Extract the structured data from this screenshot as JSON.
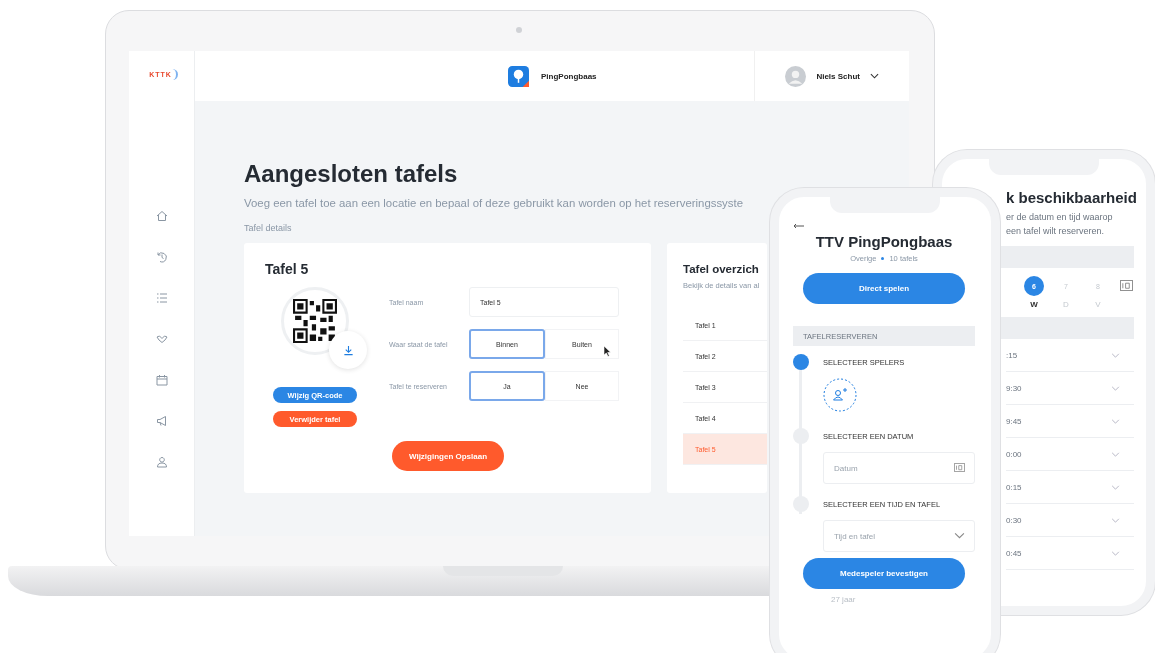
{
  "laptop": {
    "sidebar": {
      "logo": "KTTK",
      "items": [
        {
          "kind": "home"
        },
        {
          "kind": "history"
        },
        {
          "kind": "list"
        },
        {
          "kind": "hands"
        },
        {
          "kind": "calendar"
        },
        {
          "kind": "megaphone"
        },
        {
          "kind": "user"
        }
      ]
    },
    "topbar": {
      "app_name": "PingPongbaas",
      "user_name": "Niels Schut"
    },
    "page": {
      "title": "Aangesloten tafels",
      "subtitle": "Voeg een tafel toe aan een locatie en bepaal of deze gebruikt kan worden op het reserveringssyste",
      "section_label": "Tafel details"
    },
    "detail_card": {
      "title": "Tafel 5",
      "buttons": [
        {
          "label": "Wijzig QR-code",
          "kind": "primary"
        },
        {
          "label": "Verwijder tafel",
          "kind": "danger"
        }
      ],
      "fields": [
        {
          "kind": "text",
          "label": "Tafel naam",
          "value": "Tafel 5"
        },
        {
          "kind": "toggle",
          "label": "Waar staat de tafel",
          "options": [
            {
              "label": "Binnen",
              "selected": true
            },
            {
              "label": "Buiten",
              "selected": false
            }
          ]
        },
        {
          "kind": "toggle",
          "label": "Tafel te reserveren",
          "options": [
            {
              "label": "Ja",
              "selected": true
            },
            {
              "label": "Nee",
              "selected": false
            }
          ]
        }
      ],
      "save_button": "Wijzigingen Opslaan"
    },
    "overview_card": {
      "title": "Tafel overzich",
      "subtitle": "Bekijk de details van al",
      "rows": [
        {
          "label": "Tafel 1",
          "selected": false
        },
        {
          "label": "Tafel 2",
          "selected": false
        },
        {
          "label": "Tafel 3",
          "selected": false
        },
        {
          "label": "Tafel 4",
          "selected": false
        },
        {
          "label": "Tafel 5",
          "selected": true
        }
      ]
    }
  },
  "phone_booking": {
    "title": "TTV PingPongbaas",
    "category": "Overige",
    "table_count": "10 tafels",
    "play_button": "Direct spelen",
    "section_label": "TAFELRESERVEREN",
    "steps": [
      {
        "label": "SELECTEER SPELERS",
        "active": true,
        "kind": "players"
      },
      {
        "label": "SELECTEER EEN DATUM",
        "active": false,
        "kind": "date",
        "placeholder": "Datum"
      },
      {
        "label": "SELECTEER EEN TIJD EN TAFEL",
        "active": false,
        "kind": "select",
        "placeholder": "Tijd en tafel"
      }
    ],
    "confirm_button": "Medespeler bevestigen",
    "player_age": "27 jaar"
  },
  "phone_availability": {
    "title": "k beschikbaarheid",
    "description_lines": [
      "er de datum en tijd waarop",
      "een tafel wilt reserveren."
    ],
    "days": [
      {
        "number": "6",
        "weekday": "W",
        "selected": true
      },
      {
        "number": "7",
        "weekday": "D",
        "selected": false
      },
      {
        "number": "8",
        "weekday": "V",
        "selected": false
      }
    ],
    "times": [
      ":15",
      "9:30",
      "9:45",
      "0:00",
      "0:15",
      "0:30",
      "0:45"
    ]
  }
}
